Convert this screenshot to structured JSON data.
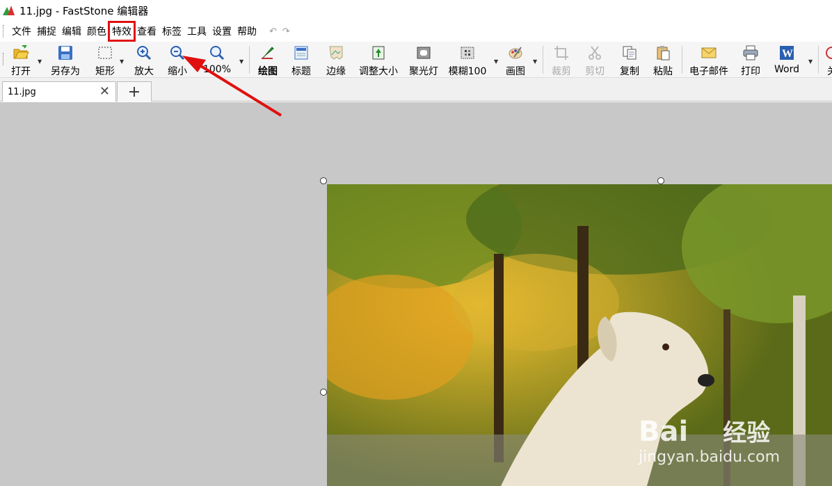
{
  "window": {
    "title": "11.jpg - FastStone 编辑器"
  },
  "menu": [
    "文件",
    "捕捉",
    "编辑",
    "颜色",
    "特效",
    "查看",
    "标签",
    "工具",
    "设置",
    "帮助"
  ],
  "menu_highlight": "特效",
  "toolbar": {
    "open": "打开",
    "save_as": "另存为",
    "rect": "矩形",
    "zoom_in": "放大",
    "zoom_out": "缩小",
    "zoom_100": "100%",
    "draw": "绘图",
    "caption": "标题",
    "edge": "边缘",
    "resize": "调整大小",
    "spotlight": "聚光灯",
    "blur": "模糊100",
    "paint": "画图",
    "crop": "裁剪",
    "cut": "剪切",
    "copy": "复制",
    "paste": "粘贴",
    "email": "电子邮件",
    "print": "打印",
    "word": "Word",
    "close": "关"
  },
  "tabs": [
    {
      "label": "11.jpg"
    }
  ],
  "watermark": {
    "brand": "Bai",
    "brand_cn": "经验",
    "url": "jingyan.baidu.com"
  },
  "colors": {
    "highlight": "#e01010",
    "arrow": "#e01010",
    "canvas": "#c8c8c8"
  }
}
